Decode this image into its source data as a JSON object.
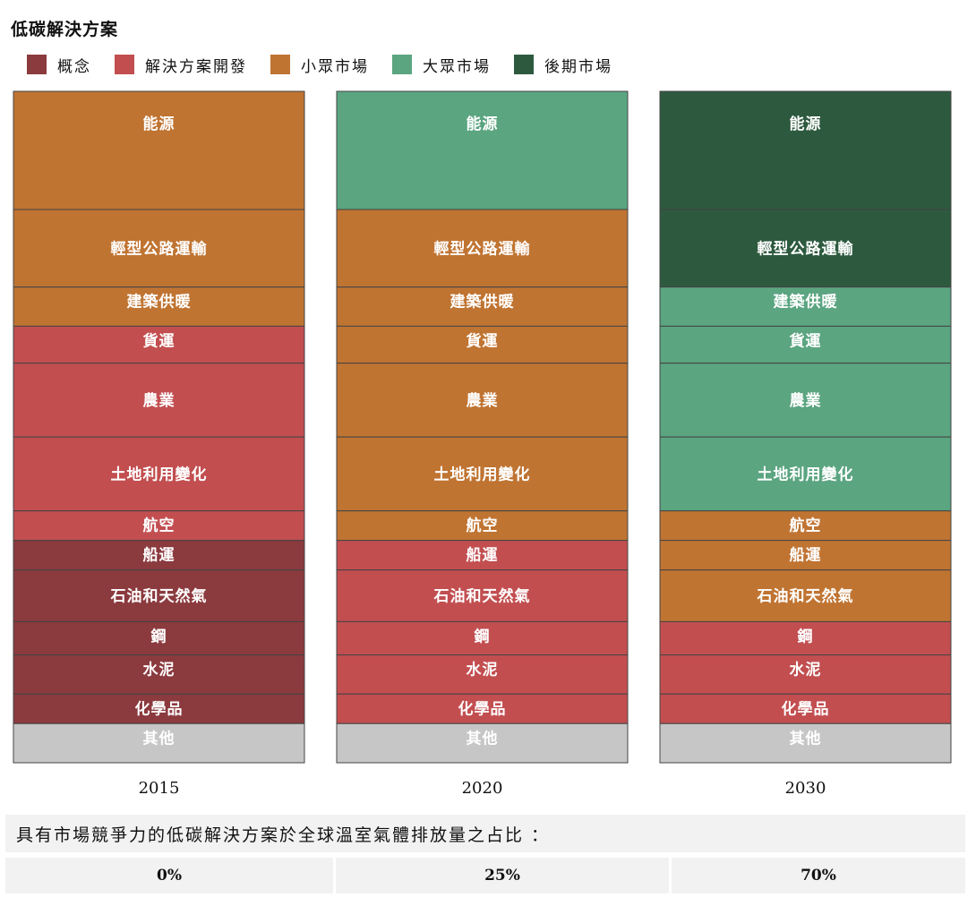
{
  "chart_data": {
    "type": "bar",
    "title": "低碳解決方案",
    "stages": [
      {
        "name": "概念",
        "color": "#8b3a3e"
      },
      {
        "name": "解決方案開發",
        "color": "#c24e50"
      },
      {
        "name": "小眾市場",
        "color": "#c07432"
      },
      {
        "name": "大眾市場",
        "color": "#5ba581"
      },
      {
        "name": "後期市場",
        "color": "#2d5a3f"
      }
    ],
    "other_color": "#c6c6c6",
    "sectors": [
      {
        "name": "能源",
        "share": 16
      },
      {
        "name": "輕型公路運輸",
        "share": 10.5
      },
      {
        "name": "建築供暖",
        "share": 5.3
      },
      {
        "name": "貨運",
        "share": 5
      },
      {
        "name": "農業",
        "share": 10
      },
      {
        "name": "土地利用變化",
        "share": 10
      },
      {
        "name": "航空",
        "share": 4
      },
      {
        "name": "船運",
        "share": 4
      },
      {
        "name": "石油和天然氣",
        "share": 7
      },
      {
        "name": "鋼",
        "share": 4.5
      },
      {
        "name": "水泥",
        "share": 5.3
      },
      {
        "name": "化學品",
        "share": 4
      },
      {
        "name": "其他",
        "share": 5.3
      }
    ],
    "columns": [
      {
        "year": "2015",
        "stages": [
          "小眾市場",
          "小眾市場",
          "小眾市場",
          "解決方案開發",
          "解決方案開發",
          "解決方案開發",
          "解決方案開發",
          "概念",
          "概念",
          "概念",
          "概念",
          "概念",
          "其他"
        ]
      },
      {
        "year": "2020",
        "stages": [
          "大眾市場",
          "小眾市場",
          "小眾市場",
          "小眾市場",
          "小眾市場",
          "小眾市場",
          "小眾市場",
          "解決方案開發",
          "解決方案開發",
          "解決方案開發",
          "解決方案開發",
          "解決方案開發",
          "其他"
        ]
      },
      {
        "year": "2030",
        "stages": [
          "後期市場",
          "後期市場",
          "大眾市場",
          "大眾市場",
          "大眾市場",
          "大眾市場",
          "小眾市場",
          "小眾市場",
          "小眾市場",
          "解決方案開發",
          "解決方案開發",
          "解決方案開發",
          "其他"
        ]
      }
    ]
  },
  "note": "具有市場競爭力的低碳解決方案於全球溫室氣體排放量之占比 ：",
  "percentages": [
    "0%",
    "25%",
    "70%"
  ]
}
